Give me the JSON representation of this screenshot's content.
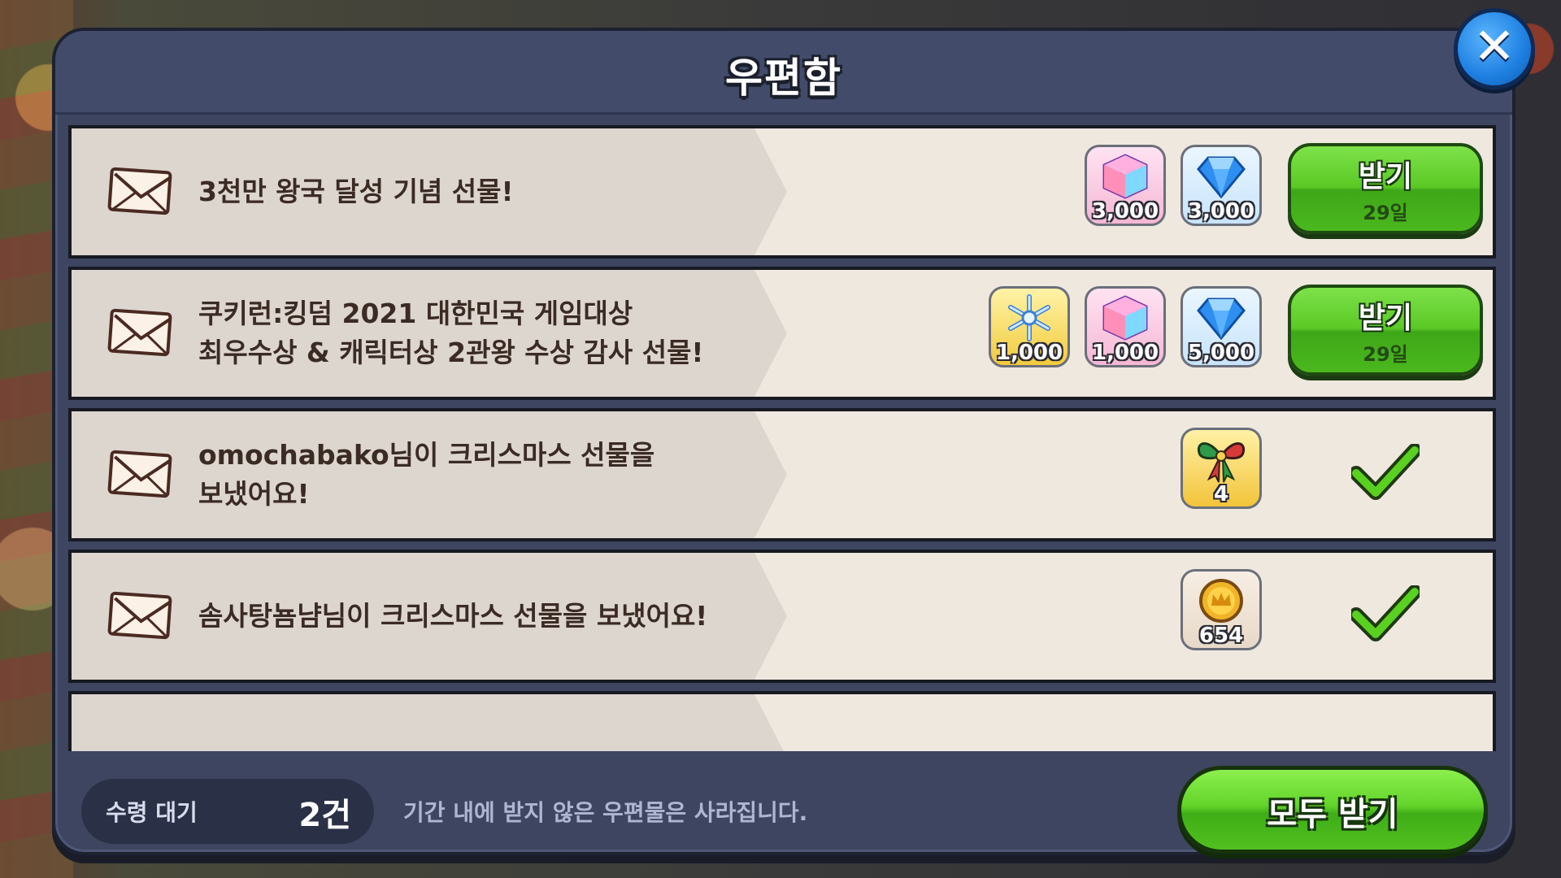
{
  "mailbox": {
    "title": "우편함",
    "close_icon": "close-icon",
    "messages": [
      {
        "lines": [
          "3천만 왕국 달성 기념 선물!"
        ],
        "rewards": [
          {
            "type": "rainbow-cube-icon",
            "amount": "3,000"
          },
          {
            "type": "crystal-gem-icon",
            "amount": "3,000"
          }
        ],
        "status": "claimable",
        "button_label": "받기",
        "days_left": "29일"
      },
      {
        "lines": [
          "쿠키런:킹덤 2021 대한민국 게임대상",
          "최우수상 & 캐릭터상 2관왕 수상 감사 선물!"
        ],
        "rewards": [
          {
            "type": "snowflake-icon",
            "amount": "1,000"
          },
          {
            "type": "rainbow-cube-icon",
            "amount": "1,000"
          },
          {
            "type": "crystal-gem-icon",
            "amount": "5,000"
          }
        ],
        "status": "claimable",
        "button_label": "받기",
        "days_left": "29일"
      },
      {
        "lines": [
          "omochabako님이 크리스마스 선물을",
          "보냈어요!"
        ],
        "rewards": [
          {
            "type": "ribbon-icon",
            "amount": "4"
          }
        ],
        "status": "claimed"
      },
      {
        "lines": [
          "솜사탕뇸냠님이 크리스마스 선물을 보냈어요!"
        ],
        "rewards": [
          {
            "type": "gold-coin-icon",
            "amount": "654"
          }
        ],
        "status": "claimed"
      }
    ],
    "footer": {
      "pending_label": "수령 대기",
      "pending_count": "2건",
      "notice": "기간 내에 받지 않은 우편물은 사라집니다.",
      "claim_all_label": "모두 받기"
    }
  },
  "colors": {
    "panel": "#3d4560",
    "row_bg": "#efe8df",
    "button_green": "#5bc925",
    "check_green": "#4cc41c"
  }
}
